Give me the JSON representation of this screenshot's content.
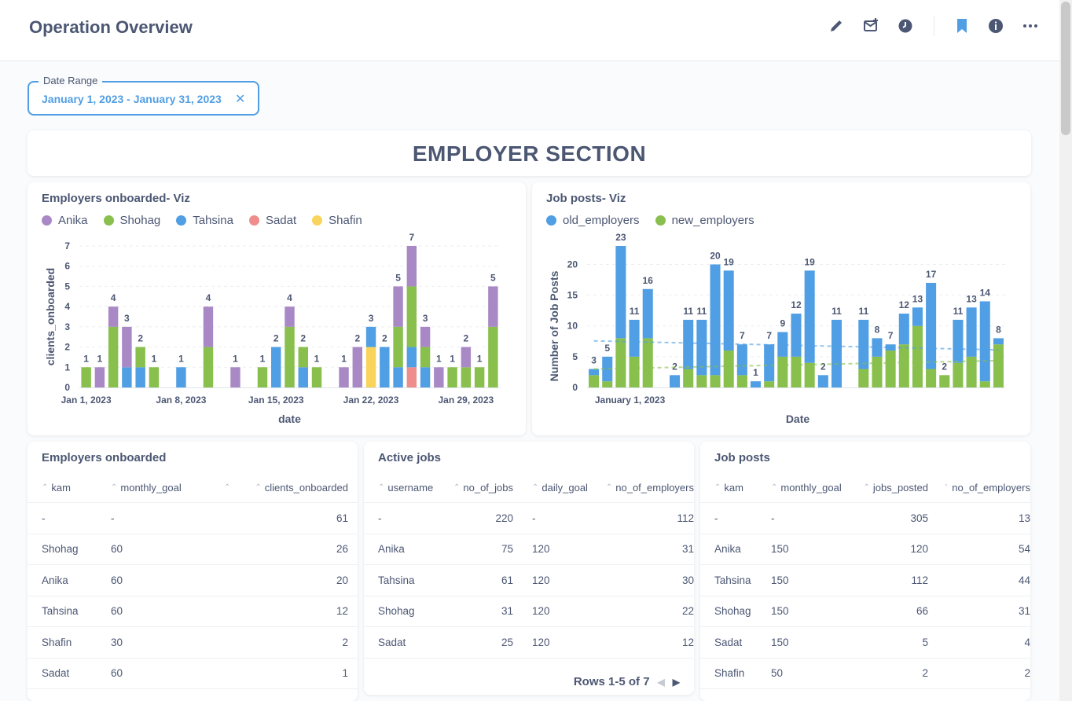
{
  "header": {
    "title": "Operation Overview",
    "icons": [
      "pencil-icon",
      "subscription-icon",
      "history-icon",
      "bookmark-icon",
      "info-icon",
      "more-icon"
    ]
  },
  "filter": {
    "label": "Date Range",
    "value": "January 1, 2023 - January 31, 2023"
  },
  "section": {
    "title": "EMPLOYER SECTION"
  },
  "colors": {
    "Anika": "#a989c5",
    "Shohag": "#88bf4d",
    "Tahsina": "#509ee3",
    "Sadat": "#ef8c8c",
    "Shafin": "#f9d45c",
    "old_employers": "#509ee3",
    "new_employers": "#88bf4d"
  },
  "chart1": {
    "title": "Employers onboarded- Viz",
    "legend": [
      "Anika",
      "Shohag",
      "Tahsina",
      "Sadat",
      "Shafin"
    ]
  },
  "chart2": {
    "title": "Job posts- Viz",
    "legend": [
      "old_employers",
      "new_employers"
    ]
  },
  "chart_data": [
    {
      "type": "bar",
      "stacked": true,
      "title": "Employers onboarded- Viz",
      "xlabel": "date",
      "ylabel": "clients_onboarded",
      "ylim": [
        0,
        7
      ],
      "yticks": [
        0,
        1,
        2,
        3,
        4,
        5,
        6,
        7
      ],
      "xtick_labels": [
        {
          "day": 1,
          "label": "Jan 1, 2023"
        },
        {
          "day": 8,
          "label": "Jan 8, 2023"
        },
        {
          "day": 15,
          "label": "Jan 15, 2023"
        },
        {
          "day": 22,
          "label": "Jan 22, 2023"
        },
        {
          "day": 29,
          "label": "Jan 29, 2023"
        }
      ],
      "bars": [
        {
          "day": 1,
          "stack": [
            {
              "series": "Shohag",
              "value": 1
            }
          ],
          "total": 1
        },
        {
          "day": 2,
          "stack": [
            {
              "series": "Anika",
              "value": 1
            }
          ],
          "total": 1
        },
        {
          "day": 3,
          "stack": [
            {
              "series": "Shohag",
              "value": 3
            },
            {
              "series": "Anika",
              "value": 1
            }
          ],
          "total": 4
        },
        {
          "day": 4,
          "stack": [
            {
              "series": "Tahsina",
              "value": 1
            },
            {
              "series": "Anika",
              "value": 2
            }
          ],
          "total": 3
        },
        {
          "day": 5,
          "stack": [
            {
              "series": "Tahsina",
              "value": 1
            },
            {
              "series": "Shohag",
              "value": 1
            }
          ],
          "total": 2
        },
        {
          "day": 6,
          "stack": [
            {
              "series": "Shohag",
              "value": 1
            }
          ],
          "total": 1
        },
        {
          "day": 8,
          "stack": [
            {
              "series": "Tahsina",
              "value": 1
            }
          ],
          "total": 1
        },
        {
          "day": 10,
          "stack": [
            {
              "series": "Shohag",
              "value": 2
            },
            {
              "series": "Anika",
              "value": 2
            }
          ],
          "total": 4
        },
        {
          "day": 12,
          "stack": [
            {
              "series": "Anika",
              "value": 1
            }
          ],
          "total": 1
        },
        {
          "day": 14,
          "stack": [
            {
              "series": "Shohag",
              "value": 1
            }
          ],
          "total": 1
        },
        {
          "day": 15,
          "stack": [
            {
              "series": "Tahsina",
              "value": 2
            }
          ],
          "total": 2
        },
        {
          "day": 16,
          "stack": [
            {
              "series": "Shohag",
              "value": 3
            },
            {
              "series": "Anika",
              "value": 1
            }
          ],
          "total": 4
        },
        {
          "day": 17,
          "stack": [
            {
              "series": "Tahsina",
              "value": 1
            },
            {
              "series": "Shohag",
              "value": 1
            }
          ],
          "total": 2
        },
        {
          "day": 18,
          "stack": [
            {
              "series": "Shohag",
              "value": 1
            }
          ],
          "total": 1
        },
        {
          "day": 20,
          "stack": [
            {
              "series": "Anika",
              "value": 1
            }
          ],
          "total": 1
        },
        {
          "day": 21,
          "stack": [
            {
              "series": "Anika",
              "value": 2
            }
          ],
          "total": 2
        },
        {
          "day": 22,
          "stack": [
            {
              "series": "Shafin",
              "value": 2
            },
            {
              "series": "Tahsina",
              "value": 1
            }
          ],
          "total": 3
        },
        {
          "day": 23,
          "stack": [
            {
              "series": "Tahsina",
              "value": 2
            }
          ],
          "total": 2
        },
        {
          "day": 24,
          "stack": [
            {
              "series": "Tahsina",
              "value": 1
            },
            {
              "series": "Shohag",
              "value": 2
            },
            {
              "series": "Anika",
              "value": 2
            }
          ],
          "total": 5
        },
        {
          "day": 25,
          "stack": [
            {
              "series": "Sadat",
              "value": 1
            },
            {
              "series": "Tahsina",
              "value": 1
            },
            {
              "series": "Shohag",
              "value": 3
            },
            {
              "series": "Anika",
              "value": 2
            }
          ],
          "total": 7
        },
        {
          "day": 26,
          "stack": [
            {
              "series": "Tahsina",
              "value": 1
            },
            {
              "series": "Shohag",
              "value": 1
            },
            {
              "series": "Anika",
              "value": 1
            }
          ],
          "total": 3
        },
        {
          "day": 27,
          "stack": [
            {
              "series": "Anika",
              "value": 1
            }
          ],
          "total": 1
        },
        {
          "day": 28,
          "stack": [
            {
              "series": "Shohag",
              "value": 1
            }
          ],
          "total": 1
        },
        {
          "day": 29,
          "stack": [
            {
              "series": "Shohag",
              "value": 1
            },
            {
              "series": "Anika",
              "value": 1
            }
          ],
          "total": 2
        },
        {
          "day": 30,
          "stack": [
            {
              "series": "Shohag",
              "value": 1
            }
          ],
          "total": 1
        },
        {
          "day": 31,
          "stack": [
            {
              "series": "Shohag",
              "value": 3
            },
            {
              "series": "Anika",
              "value": 2
            }
          ],
          "total": 5
        }
      ]
    },
    {
      "type": "bar",
      "stacked": true,
      "title": "Job posts- Viz",
      "xlabel": "Date",
      "ylabel": "Number of Job Posts",
      "ylim": [
        0,
        23
      ],
      "yticks": [
        0,
        5,
        10,
        15,
        20
      ],
      "xtick_labels": [
        {
          "day": 1,
          "label": "January 1, 2023"
        }
      ],
      "trendlines": true,
      "series": [
        {
          "name": "old_employers",
          "days": [
            1,
            2,
            3,
            4,
            5,
            6,
            7,
            8,
            9,
            10,
            11,
            12,
            13,
            14,
            15,
            16,
            17,
            18,
            19,
            20,
            21,
            22,
            23,
            24,
            25,
            26,
            27,
            28,
            29,
            30,
            31
          ],
          "values": [
            1,
            4,
            15,
            6,
            8,
            0,
            0,
            2,
            8,
            9,
            18,
            13,
            5,
            0,
            6,
            4,
            7,
            15,
            2,
            11,
            0,
            8,
            3,
            1,
            2,
            2,
            14,
            0,
            7,
            8,
            12,
            13,
            1
          ]
        },
        {
          "name": "new_employers",
          "days": [],
          "values": []
        }
      ],
      "bars": [
        {
          "day": 1,
          "old": 1,
          "new": 2,
          "total": 3
        },
        {
          "day": 2,
          "old": 4,
          "new": 1,
          "total": 5
        },
        {
          "day": 3,
          "old": 15,
          "new": 8,
          "total": 23
        },
        {
          "day": 4,
          "old": 6,
          "new": 5,
          "total": 11
        },
        {
          "day": 5,
          "old": 8,
          "new": 8,
          "total": 16
        },
        {
          "day": 7,
          "old": 2,
          "new": 0,
          "total": 2
        },
        {
          "day": 8,
          "old": 8,
          "new": 3,
          "total": 11
        },
        {
          "day": 9,
          "old": 9,
          "new": 2,
          "total": 11
        },
        {
          "day": 10,
          "old": 18,
          "new": 2,
          "total": 20
        },
        {
          "day": 11,
          "old": 13,
          "new": 6,
          "total": 19
        },
        {
          "day": 12,
          "old": 5,
          "new": 2,
          "total": 7
        },
        {
          "day": 13,
          "old": 1,
          "new": 0,
          "total": 1
        },
        {
          "day": 14,
          "old": 6,
          "new": 1,
          "total": 7
        },
        {
          "day": 15,
          "old": 4,
          "new": 5,
          "total": 9
        },
        {
          "day": 16,
          "old": 7,
          "new": 5,
          "total": 12
        },
        {
          "day": 17,
          "old": 15,
          "new": 4,
          "total": 19
        },
        {
          "day": 18,
          "old": 2,
          "new": 0,
          "total": 2
        },
        {
          "day": 19,
          "old": 11,
          "new": 0,
          "total": 11
        },
        {
          "day": 21,
          "old": 8,
          "new": 3,
          "total": 11
        },
        {
          "day": 22,
          "old": 3,
          "new": 5,
          "total": 8
        },
        {
          "day": 23,
          "old": 1,
          "new": 6,
          "total": 7
        },
        {
          "day": 24,
          "old": 5,
          "new": 7,
          "total": 12
        },
        {
          "day": 25,
          "old": 3,
          "new": 10,
          "total": 13
        },
        {
          "day": 26,
          "old": 14,
          "new": 3,
          "total": 17
        },
        {
          "day": 27,
          "old": 0,
          "new": 2,
          "total": 2
        },
        {
          "day": 28,
          "old": 7,
          "new": 4,
          "total": 11
        },
        {
          "day": 29,
          "old": 8,
          "new": 5,
          "total": 13
        },
        {
          "day": 30,
          "old": 13,
          "new": 1,
          "total": 14
        },
        {
          "day": 31,
          "old": 1,
          "new": 7,
          "total": 8
        }
      ]
    }
  ],
  "tables": [
    {
      "title": "Employers onboarded",
      "columns": [
        "kam",
        "monthly_goal",
        "",
        "clients_onboarded"
      ],
      "rows": [
        [
          "-",
          "-",
          "",
          "61"
        ],
        [
          "Shohag",
          "60",
          "",
          "26"
        ],
        [
          "Anika",
          "60",
          "",
          "20"
        ],
        [
          "Tahsina",
          "60",
          "",
          "12"
        ],
        [
          "Shafin",
          "30",
          "",
          "2"
        ],
        [
          "Sadat",
          "60",
          "",
          "1"
        ]
      ]
    },
    {
      "title": "Active jobs",
      "columns": [
        "username",
        "no_of_jobs",
        "daily_goal",
        "no_of_employers"
      ],
      "rows": [
        [
          "-",
          "220",
          "-",
          "112"
        ],
        [
          "Anika",
          "75",
          "120",
          "31"
        ],
        [
          "Tahsina",
          "61",
          "120",
          "30"
        ],
        [
          "Shohag",
          "31",
          "120",
          "22"
        ],
        [
          "Sadat",
          "25",
          "120",
          "12"
        ]
      ],
      "pager": "Rows 1-5 of 7"
    },
    {
      "title": "Job posts",
      "columns": [
        "kam",
        "monthly_goal",
        "jobs_posted",
        "no_of_employers"
      ],
      "rows": [
        [
          "-",
          "-",
          "305",
          "13"
        ],
        [
          "Anika",
          "150",
          "120",
          "54"
        ],
        [
          "Tahsina",
          "150",
          "112",
          "44"
        ],
        [
          "Shohag",
          "150",
          "66",
          "31"
        ],
        [
          "Sadat",
          "150",
          "5",
          "4"
        ],
        [
          "Shafin",
          "50",
          "2",
          "2"
        ]
      ]
    }
  ]
}
